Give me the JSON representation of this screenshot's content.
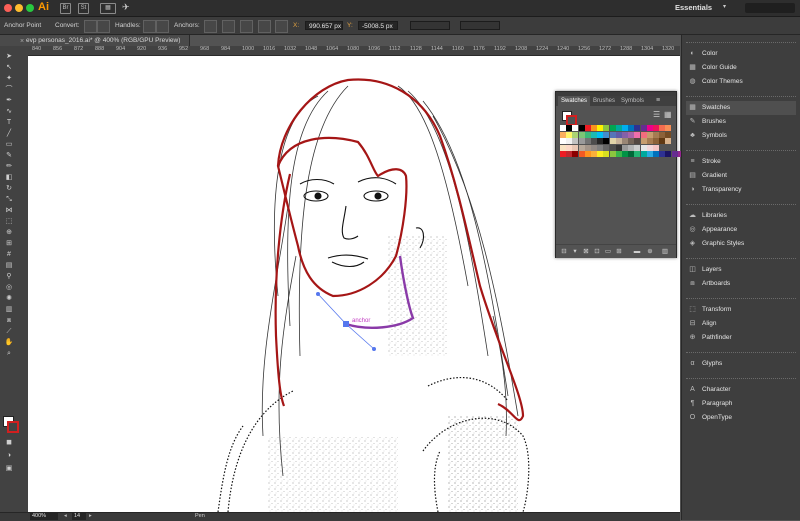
{
  "app": {
    "logo": "Ai",
    "workspace": "Essentials"
  },
  "control_bar": {
    "tool_name": "Anchor Point",
    "convert_label": "Convert:",
    "handles_label": "Handles:",
    "anchors_label": "Anchors:",
    "x_label": "X:",
    "x_value": "990.657 px",
    "y_label": "Y:",
    "y_value": "-5008.5 px"
  },
  "document": {
    "tab_title": "evp personas_2016.ai* @ 400% (RGB/GPU Preview)"
  },
  "ruler": {
    "ticks": [
      "840",
      "856",
      "872",
      "888",
      "904",
      "920",
      "936",
      "952",
      "968",
      "984",
      "1000",
      "1016",
      "1032",
      "1048",
      "1064",
      "1080",
      "1096",
      "1112",
      "1128",
      "1144",
      "1160",
      "1176",
      "1192",
      "1208",
      "1224",
      "1240",
      "1256",
      "1272",
      "1288",
      "1304",
      "1320"
    ]
  },
  "canvas": {
    "anchor_hint": "anchor"
  },
  "status_bar": {
    "zoom": "400%",
    "artboard": "14",
    "tool": "Pen"
  },
  "swatches_panel": {
    "tabs": [
      "Swatches",
      "Brushes",
      "Symbols"
    ],
    "rows": [
      [
        "#ffffff",
        "#000000",
        "#ffffff",
        "#000000",
        "#ed1c24",
        "#f7941d",
        "#fff200",
        "#8dc63f",
        "#00a651",
        "#00a99d",
        "#00aeef",
        "#0072bc",
        "#2e3192",
        "#662d91",
        "#ec008c",
        "#ed145b",
        "#f26c4f",
        "#f68e56"
      ],
      [
        "#fbaf5d",
        "#fff568",
        "#acd373",
        "#7cc576",
        "#3cb878",
        "#1cbbb4",
        "#00bff3",
        "#448ccb",
        "#5674b9",
        "#605ca8",
        "#8560a8",
        "#a864a8",
        "#f06eaa",
        "#f26d7d",
        "#c69c6d",
        "#a67c52",
        "#8c6239",
        "#754c24"
      ],
      [
        "#ffffff",
        "#f2f2f2",
        "#c2c2c2",
        "#9a9a9a",
        "#737373",
        "#4d4d4d",
        "#262626",
        "#000000",
        "#e0d3a8",
        "#c7b299",
        "#998675",
        "#736357",
        "#534741",
        "#c69c6d",
        "#a67c52",
        "#8c6239",
        "#603913",
        "#d9b38c"
      ],
      [
        "#f9e3c2",
        "#fcd9c7",
        "#e9c7b4",
        "#b8a99a",
        "#a39589",
        "#928a85",
        "#7f7f7f",
        "#666666",
        "#4c4c4c",
        "#333333",
        "#999999",
        "#b3b3b3",
        "#cccccc",
        "#e6e6e6",
        "#f2d7d9",
        "#f5c6c6"
      ],
      [
        "#ed1c24",
        "#c1272d",
        "#8b0000",
        "#f15a24",
        "#ff931e",
        "#fbb03b",
        "#fcee21",
        "#d9e021",
        "#8cc63f",
        "#39b54a",
        "#009245",
        "#006837",
        "#22b573",
        "#00a99d",
        "#29abe2",
        "#0071bc",
        "#2e3192",
        "#1b1464",
        "#662d91",
        "#93278f",
        "#9e005d",
        "#d4145a"
      ]
    ]
  },
  "right_panel": {
    "groups": [
      [
        {
          "label": "Color",
          "icon": "color-icon"
        },
        {
          "label": "Color Guide",
          "icon": "color-guide-icon"
        },
        {
          "label": "Color Themes",
          "icon": "color-themes-icon"
        }
      ],
      [
        {
          "label": "Swatches",
          "icon": "swatches-icon"
        },
        {
          "label": "Brushes",
          "icon": "brushes-icon"
        },
        {
          "label": "Symbols",
          "icon": "symbols-icon"
        }
      ],
      [
        {
          "label": "Stroke",
          "icon": "stroke-icon"
        },
        {
          "label": "Gradient",
          "icon": "gradient-icon"
        },
        {
          "label": "Transparency",
          "icon": "transparency-icon"
        }
      ],
      [
        {
          "label": "Libraries",
          "icon": "libraries-icon"
        },
        {
          "label": "Appearance",
          "icon": "appearance-icon"
        },
        {
          "label": "Graphic Styles",
          "icon": "graphic-styles-icon"
        }
      ],
      [
        {
          "label": "Layers",
          "icon": "layers-icon"
        },
        {
          "label": "Artboards",
          "icon": "artboards-icon"
        }
      ],
      [
        {
          "label": "Transform",
          "icon": "transform-icon"
        },
        {
          "label": "Align",
          "icon": "align-icon"
        },
        {
          "label": "Pathfinder",
          "icon": "pathfinder-icon"
        }
      ],
      [
        {
          "label": "Glyphs",
          "icon": "glyphs-icon"
        }
      ],
      [
        {
          "label": "Character",
          "icon": "character-icon"
        },
        {
          "label": "Paragraph",
          "icon": "paragraph-icon"
        },
        {
          "label": "OpenType",
          "icon": "opentype-icon"
        }
      ]
    ]
  }
}
